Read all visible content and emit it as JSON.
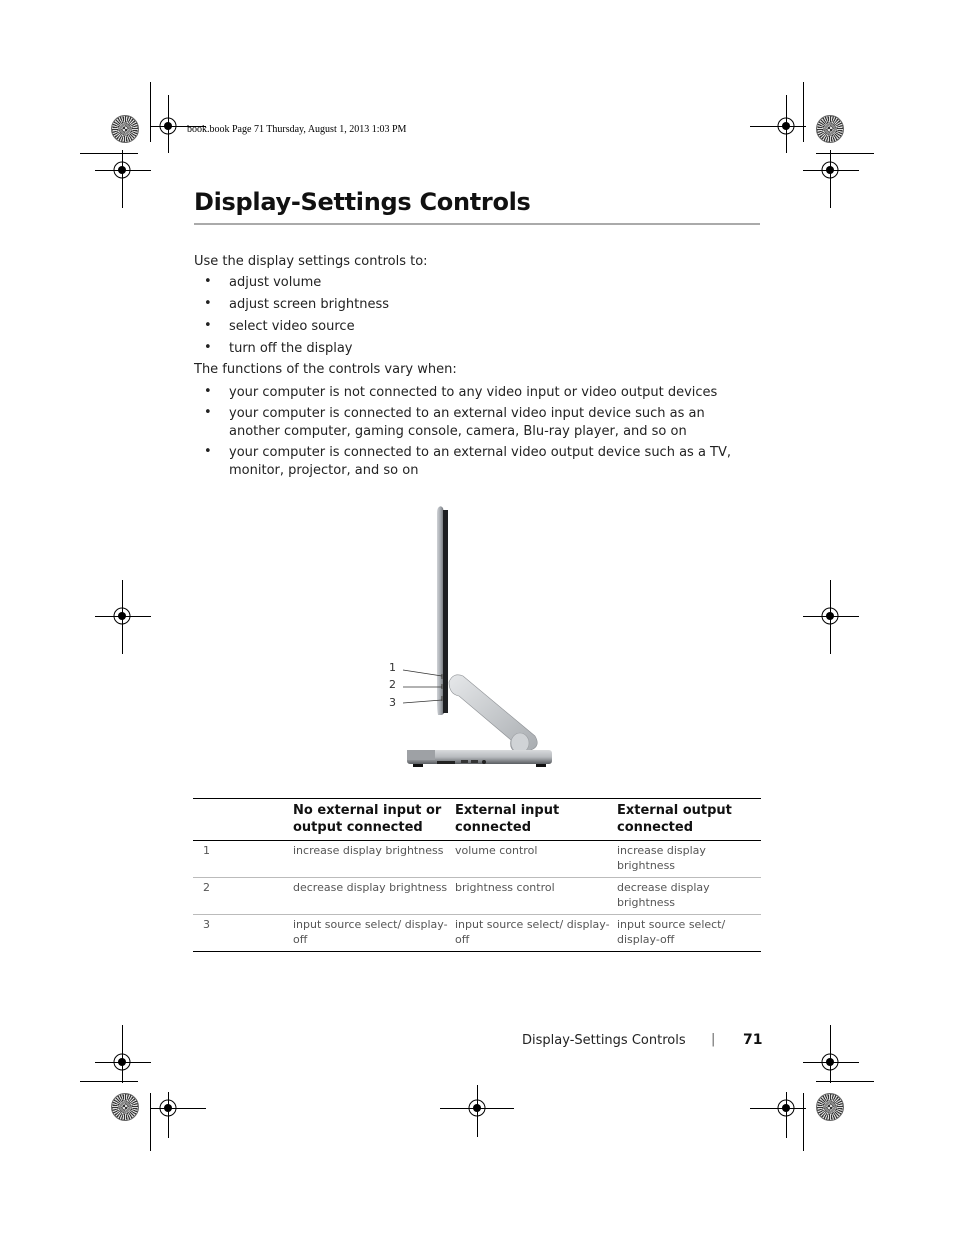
{
  "print_header": "book.book  Page 71  Thursday, August 1, 2013  1:03 PM",
  "title": "Display-Settings Controls",
  "intro": "Use the display settings controls to:",
  "uses": [
    "adjust volume",
    "adjust screen brightness",
    "select video source",
    "turn off the display"
  ],
  "vary_intro": "The functions of the controls vary when:",
  "conditions": [
    "your computer is not connected to any video input or video output devices",
    "your computer is connected to an external video input device such as an another computer, gaming console, camera, Blu-ray player, and so on",
    "your computer is connected to an external video output device such as a TV, monitor, projector, and so on"
  ],
  "figure": {
    "description": "side view of all-in-one computer with display-settings buttons",
    "callouts": [
      "1",
      "2",
      "3"
    ]
  },
  "table": {
    "headers": [
      "",
      "No external input or output connected",
      "External input connected",
      "External output connected"
    ],
    "rows": [
      [
        "1",
        "increase display brightness",
        "volume control",
        "increase display brightness"
      ],
      [
        "2",
        "decrease display brightness",
        "brightness control",
        "decrease display brightness"
      ],
      [
        "3",
        "input source select/ display-off",
        "input source select/ display-off",
        "input source select/ display-off"
      ]
    ]
  },
  "footer": {
    "section": "Display-Settings Controls",
    "separator": "|",
    "page_number": "71"
  }
}
